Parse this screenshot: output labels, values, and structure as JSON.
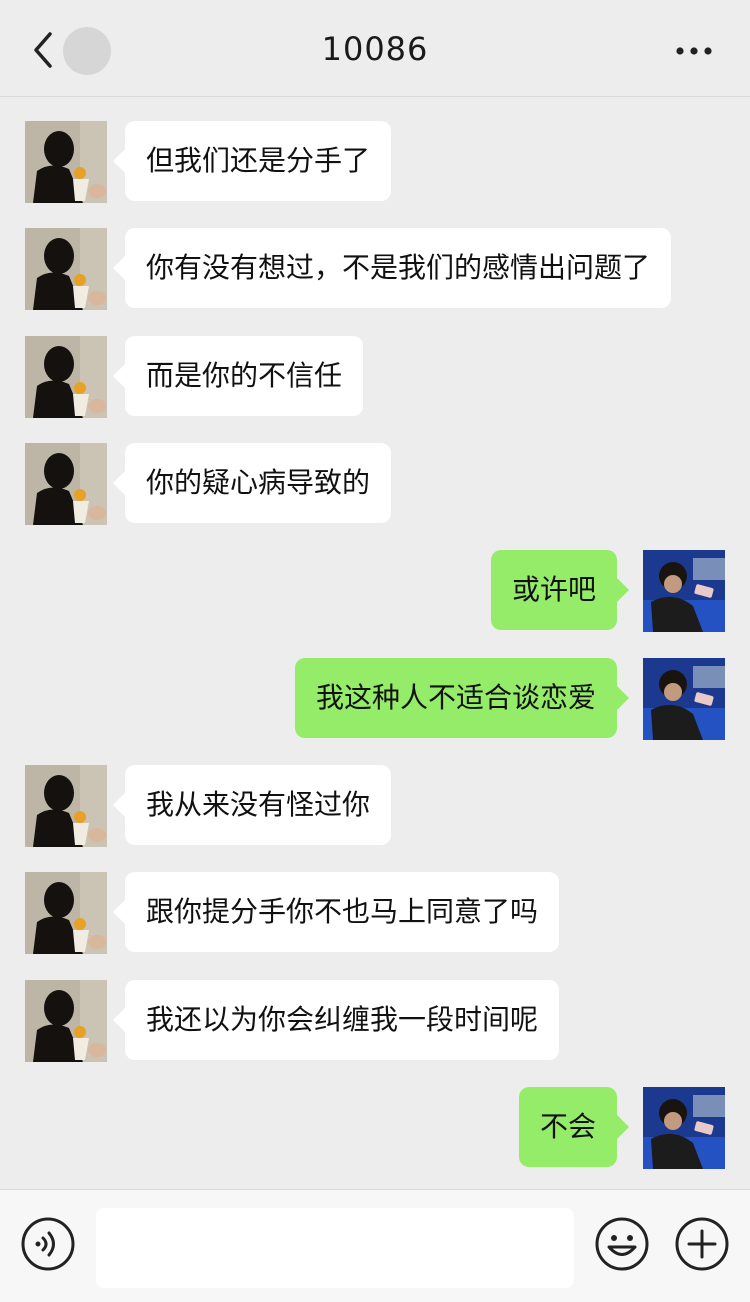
{
  "header": {
    "title": "10086"
  },
  "messages": [
    {
      "side": "in",
      "text": "但我们还是分手了"
    },
    {
      "side": "in",
      "text": "你有没有想过，不是我们的感情出问题了"
    },
    {
      "side": "in",
      "text": "而是你的不信任"
    },
    {
      "side": "in",
      "text": "你的疑心病导致的"
    },
    {
      "side": "out",
      "text": "或许吧"
    },
    {
      "side": "out",
      "text": "我这种人不适合谈恋爱"
    },
    {
      "side": "in",
      "text": "我从来没有怪过你"
    },
    {
      "side": "in",
      "text": "跟你提分手你不也马上同意了吗"
    },
    {
      "side": "in",
      "text": "我还以为你会纠缠我一段时间呢"
    },
    {
      "side": "out",
      "text": "不会"
    }
  ],
  "input_bar": {
    "value": ""
  },
  "colors": {
    "background": "#ededed",
    "incoming_bubble": "#ffffff",
    "outgoing_bubble": "#95ec69"
  },
  "icons": [
    "back-icon",
    "more-icon",
    "voice-icon",
    "emoji-icon",
    "plus-icon"
  ]
}
